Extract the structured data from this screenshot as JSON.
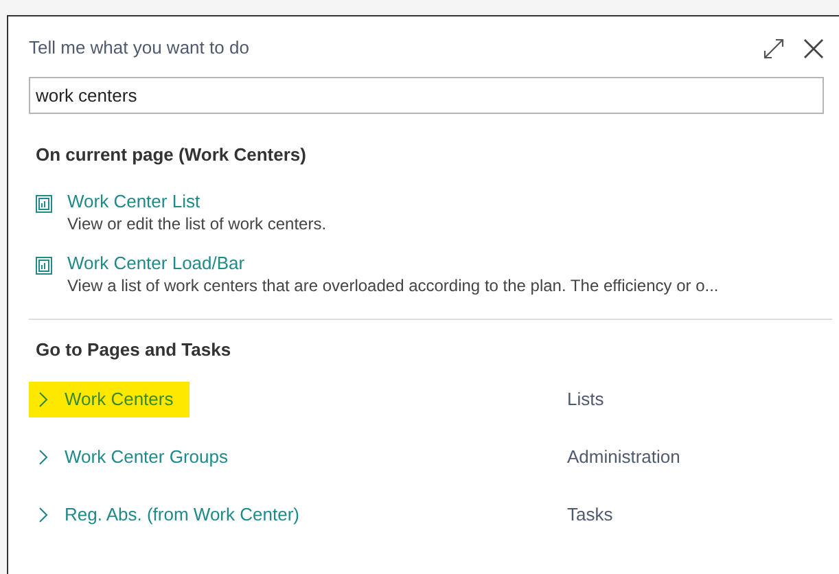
{
  "dialog": {
    "title": "Tell me what you want to do"
  },
  "search": {
    "value": "work centers"
  },
  "current_page": {
    "heading": "On current page (Work Centers)",
    "items": [
      {
        "title": "Work Center List",
        "description": "View or edit the list of work centers."
      },
      {
        "title": "Work Center Load/Bar",
        "description": "View a list of work centers that are overloaded according to the plan. The efficiency or o..."
      }
    ]
  },
  "pages_and_tasks": {
    "heading": "Go to Pages and Tasks",
    "rows": [
      {
        "title": "Work Centers",
        "category": "Lists",
        "highlighted": true
      },
      {
        "title": "Work Center Groups",
        "category": "Administration",
        "highlighted": false
      },
      {
        "title": "Reg. Abs. (from Work Center)",
        "category": "Tasks",
        "highlighted": false
      }
    ]
  }
}
